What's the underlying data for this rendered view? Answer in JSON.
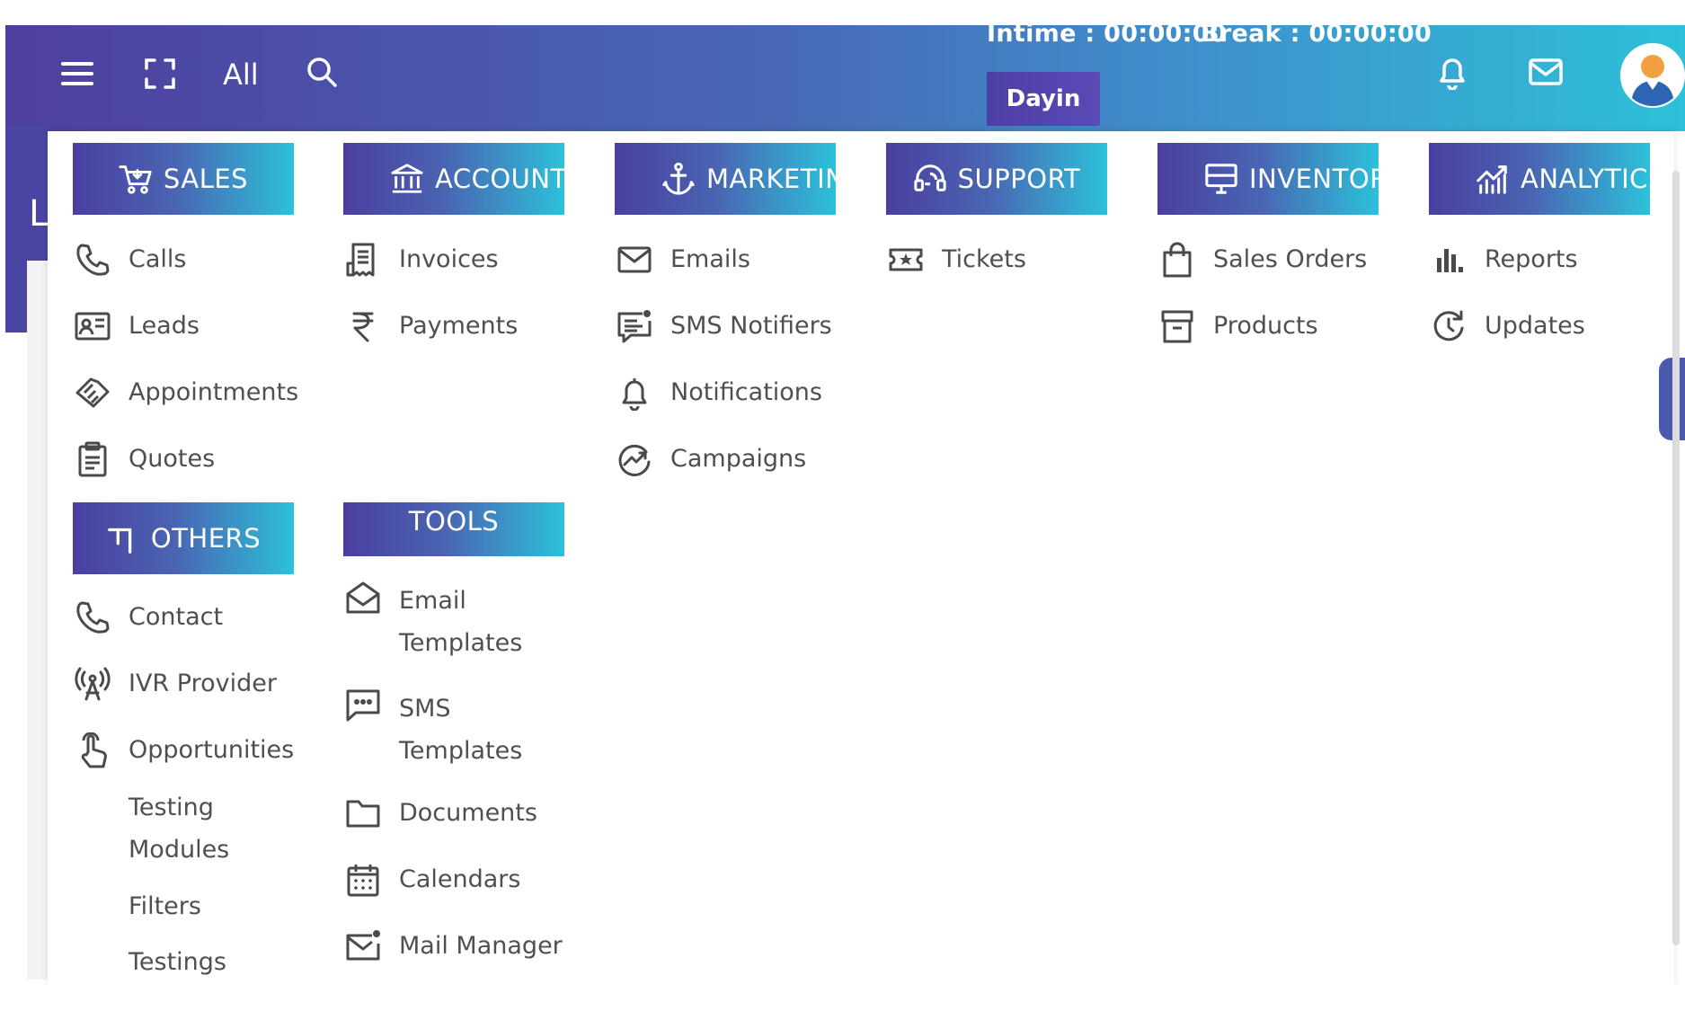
{
  "topbar": {
    "all_label": "All",
    "intime": "Intime : 00:00:00",
    "break": "Break : 00:00:00",
    "dayin_button": "Dayin",
    "side_letter": "L"
  },
  "columns": [
    {
      "header": "SALES",
      "items": [
        "Calls",
        "Leads",
        "Appointments",
        "Quotes"
      ]
    },
    {
      "header": "ACCOUNT",
      "items": [
        "Invoices",
        "Payments"
      ]
    },
    {
      "header": "MARKETIN",
      "items": [
        "Emails",
        "SMS Notifiers",
        "Notifications",
        "Campaigns"
      ]
    },
    {
      "header": "SUPPORT",
      "items": [
        "Tickets"
      ]
    },
    {
      "header": "INVENTOR",
      "items": [
        "Sales Orders",
        "Products"
      ]
    },
    {
      "header": "ANALYTICS",
      "items": [
        "Reports",
        "Updates"
      ]
    }
  ],
  "others": {
    "header": "OTHERS",
    "items": [
      "Contact",
      "IVR Provider",
      "Opportunities",
      "Testing Modules",
      "Filters",
      "Testings"
    ]
  },
  "tools": {
    "header": "TOOLS",
    "items": [
      "Email Templates",
      "SMS Templates",
      "Documents",
      "Calendars",
      "Mail Manager"
    ]
  },
  "icons": {
    "calls": "phone-icon",
    "leads": "id-card-icon",
    "appointments": "handshake-icon",
    "quotes": "clipboard-icon",
    "invoices": "receipt-icon",
    "payments": "rupee-icon",
    "emails": "envelope-icon",
    "sms_notifiers": "chat-lines-icon",
    "notifications": "bell-icon",
    "campaigns": "trend-circle-icon",
    "tickets": "ticket-star-icon",
    "sales_orders": "shopping-bag-icon",
    "products": "archive-box-icon",
    "reports": "bar-chart-icon",
    "updates": "refresh-clock-icon"
  },
  "colors": {
    "gradient_start": "#4a3f9f",
    "gradient_mid": "#4a63b2",
    "gradient_end": "#2cc1da",
    "text": "#4f4f4f"
  }
}
